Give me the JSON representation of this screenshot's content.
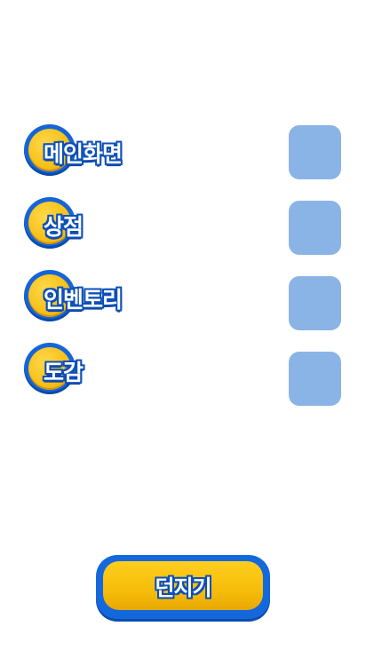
{
  "menu": {
    "items": [
      {
        "label": "메인화면",
        "icon": "coin-icon"
      },
      {
        "label": "상점",
        "icon": "coin-icon"
      },
      {
        "label": "인벤토리",
        "icon": "coin-icon"
      },
      {
        "label": "도감",
        "icon": "coin-icon"
      }
    ]
  },
  "throw_button": {
    "label": "던지기"
  },
  "colors": {
    "coin_gold": "#f7c21a",
    "outline_blue": "#1565d8",
    "slot_blue": "#8ab4e6",
    "button_gold": "#f6bd0a"
  }
}
